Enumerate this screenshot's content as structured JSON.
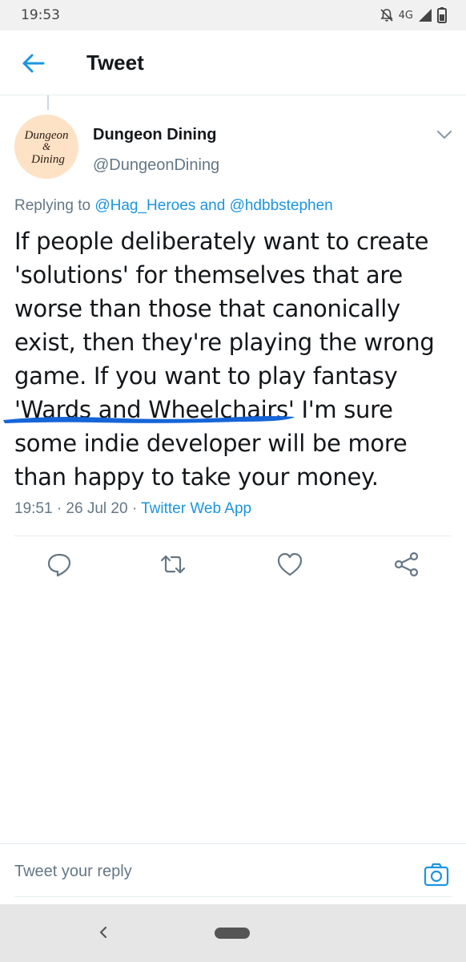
{
  "status_bar": {
    "time": "19:53",
    "network": "4G"
  },
  "header": {
    "title": "Tweet"
  },
  "tweet": {
    "avatar_text": {
      "line1": "Dungeon",
      "line2": "&",
      "line3": "Dining"
    },
    "display_name": "Dungeon Dining",
    "handle": "@DungeonDining",
    "replying_prefix": "Replying to ",
    "replying_user1": "@Hag_Heroes",
    "replying_and": " and ",
    "replying_user2": "@hdbbstephen",
    "text": "If people deliberately want to create 'solutions' for themselves that are worse than those that canonically exist, then they're playing the wrong game. If you want to play fantasy 'Wards and Wheelchairs' I'm sure some indie developer will be more than happy to take your money.",
    "timestamp": "19:51 · 26 Jul 20 · ",
    "source_app": "Twitter Web App"
  },
  "actions": [
    "reply",
    "retweet",
    "like",
    "share"
  ],
  "reply_bar": {
    "placeholder": "Tweet your reply"
  },
  "colors": {
    "accent": "#1b95e0",
    "secondary_text": "#657786",
    "underline_mark": "#1565d8"
  }
}
